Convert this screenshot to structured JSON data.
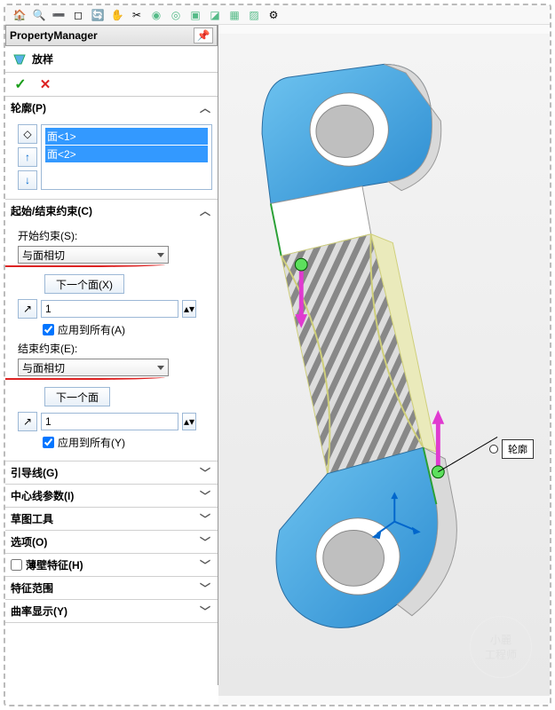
{
  "toolbar_icons": [
    "home",
    "zoom-in",
    "zoom-out",
    "fit",
    "rotate",
    "pan",
    "section",
    "shaded",
    "hidden",
    "wire",
    "shadow",
    "perspective",
    "scene",
    "settings"
  ],
  "pm": {
    "title": "PropertyManager"
  },
  "feature": {
    "name": "放样",
    "ok": "✓",
    "cancel": "✕"
  },
  "profiles": {
    "title": "轮廓(P)",
    "items": [
      "面<1>",
      "面<2>"
    ]
  },
  "constraints": {
    "title": "起始/结束约束(C)",
    "start_label": "开始约束(S):",
    "start_value": "与面相切",
    "next_face_x": "下一个面(X)",
    "tangent_length1": "1",
    "apply_all_a": "应用到所有(A)",
    "end_label": "结束约束(E):",
    "end_value": "与面相切",
    "next_face": "下一个面",
    "tangent_length2": "1",
    "apply_all_y": "应用到所有(Y)"
  },
  "sections": {
    "guides": "引导线(G)",
    "centerline": "中心线参数(I)",
    "sketch_tools": "草图工具",
    "options": "选项(O)",
    "thin": "薄壁特征(H)",
    "scope": "特征范围",
    "curvature": "曲率显示(Y)"
  },
  "callout": "轮廓",
  "watermark": {
    "l1": "小麗",
    "l2": "工程师"
  },
  "colors": {
    "blue": "#4aa8e8",
    "steel": "#c8c8c8",
    "sel": "#3399ff"
  }
}
